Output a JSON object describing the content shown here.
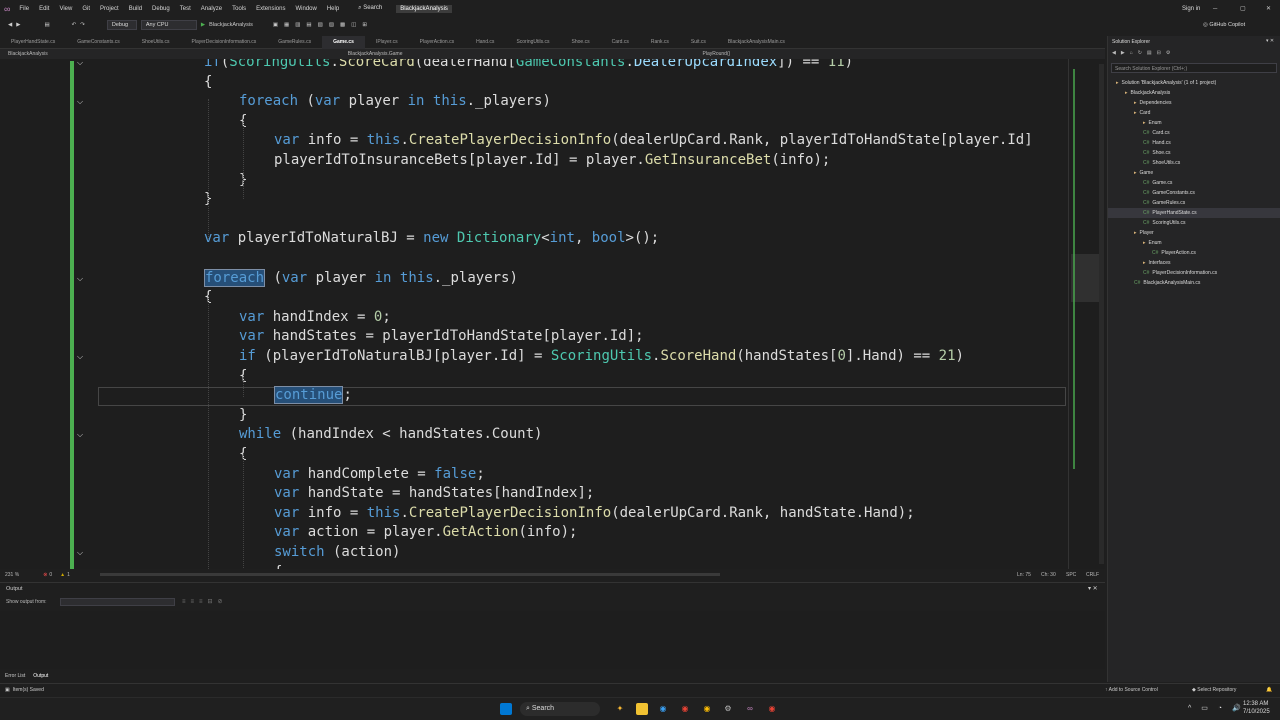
{
  "app": {
    "menu": [
      "File",
      "Edit",
      "View",
      "Git",
      "Project",
      "Build",
      "Debug",
      "Test",
      "Analyze",
      "Tools",
      "Extensions",
      "Window",
      "Help"
    ],
    "search_label": "Search",
    "solution_title": "BlackjackAnalysis",
    "sign_in": "Sign in",
    "copilot": "GitHub Copilot"
  },
  "toolbar": {
    "config": "Debug",
    "platform": "Any CPU",
    "run_target": "BlackjackAnalysis"
  },
  "tabs": [
    {
      "label": "PlayerHandState.cs",
      "active": false
    },
    {
      "label": "GameConstants.cs",
      "active": false
    },
    {
      "label": "ShoeUtils.cs",
      "active": false
    },
    {
      "label": "PlayerDecisionInformation.cs",
      "active": false
    },
    {
      "label": "GameRules.cs",
      "active": false
    },
    {
      "label": "Game.cs",
      "active": true
    },
    {
      "label": "IPlayer.cs",
      "active": false
    },
    {
      "label": "PlayerAction.cs",
      "active": false
    },
    {
      "label": "Hand.cs",
      "active": false
    },
    {
      "label": "ScoringUtils.cs",
      "active": false
    },
    {
      "label": "Shoe.cs",
      "active": false
    },
    {
      "label": "Card.cs",
      "active": false
    },
    {
      "label": "Rank.cs",
      "active": false
    },
    {
      "label": "Suit.cs",
      "active": false
    },
    {
      "label": "BlackjackAnalysisMain.cs",
      "active": false
    }
  ],
  "navbar": {
    "project": "BlackjackAnalysis",
    "scope": "BlackjackAnalysis.Game",
    "member": "PlayRound()"
  },
  "status_line": {
    "zoom": "231 %",
    "errors": "0",
    "warnings": "1",
    "position": "Ln: 75",
    "column": "Ch: 30",
    "whitespace": "SPC",
    "line_ending": "CRLF"
  },
  "output": {
    "title": "Output",
    "show_from_label": "Show output from:"
  },
  "bottom_tabs": [
    "Error List",
    "Output"
  ],
  "solution_explorer": {
    "title": "Solution Explorer",
    "search_placeholder": "Search Solution Explorer (Ctrl+;)",
    "items": [
      {
        "label": "Solution 'BlackjackAnalysis' (1 of 1 project)",
        "indent": 0,
        "selected": false
      },
      {
        "label": "BlackjackAnalysis",
        "indent": 1,
        "selected": false
      },
      {
        "label": "Dependencies",
        "indent": 2,
        "selected": false
      },
      {
        "label": "Card",
        "indent": 2,
        "selected": false
      },
      {
        "label": "Enum",
        "indent": 3,
        "selected": false
      },
      {
        "label": "Card.cs",
        "indent": 3,
        "selected": false
      },
      {
        "label": "Hand.cs",
        "indent": 3,
        "selected": false
      },
      {
        "label": "Shoe.cs",
        "indent": 3,
        "selected": false
      },
      {
        "label": "ShoeUtils.cs",
        "indent": 3,
        "selected": false
      },
      {
        "label": "Game",
        "indent": 2,
        "selected": false
      },
      {
        "label": "Game.cs",
        "indent": 3,
        "selected": false
      },
      {
        "label": "GameConstants.cs",
        "indent": 3,
        "selected": false
      },
      {
        "label": "GameRules.cs",
        "indent": 3,
        "selected": false
      },
      {
        "label": "PlayerHandState.cs",
        "indent": 3,
        "selected": true
      },
      {
        "label": "ScoringUtils.cs",
        "indent": 3,
        "selected": false
      },
      {
        "label": "Player",
        "indent": 2,
        "selected": false
      },
      {
        "label": "Enum",
        "indent": 3,
        "selected": false
      },
      {
        "label": "PlayerAction.cs",
        "indent": 4,
        "selected": false
      },
      {
        "label": "Interfaces",
        "indent": 3,
        "selected": false
      },
      {
        "label": "PlayerDecisionInformation.cs",
        "indent": 3,
        "selected": false
      },
      {
        "label": "BlackjackAnalysisMain.cs",
        "indent": 2,
        "selected": false
      }
    ]
  },
  "vs_status": {
    "message": "Item(s) Saved",
    "source_control": "Add to Source Control",
    "repository": "Select Repository"
  },
  "taskbar": {
    "search_label": "Search",
    "time": "12:38 AM",
    "date": "7/10/2025"
  },
  "code": [
    {
      "indent": 0,
      "tokens": [
        [
          "kw",
          "if"
        ],
        [
          "",
          "("
        ],
        [
          "ty",
          "ScoringUtils"
        ],
        [
          "",
          "."
        ],
        [
          "fn",
          "ScoreCard"
        ],
        [
          "",
          "(dealerHand["
        ],
        [
          "ty",
          "GameConstants"
        ],
        [
          "",
          "."
        ],
        [
          "id",
          "DealerUpcardIndex"
        ],
        [
          "",
          "]) == "
        ],
        [
          "nm",
          "11"
        ],
        [
          "",
          ")"
        ]
      ]
    },
    {
      "indent": 0,
      "tokens": [
        [
          "",
          "{"
        ]
      ]
    },
    {
      "indent": 1,
      "tokens": [
        [
          "kw",
          "foreach"
        ],
        [
          "",
          " ("
        ],
        [
          "kw",
          "var"
        ],
        [
          "",
          " player "
        ],
        [
          "kw",
          "in"
        ],
        [
          "",
          " "
        ],
        [
          "kw",
          "this"
        ],
        [
          "",
          "._players)"
        ]
      ]
    },
    {
      "indent": 1,
      "tokens": [
        [
          "",
          "{"
        ]
      ]
    },
    {
      "indent": 2,
      "tokens": [
        [
          "kw",
          "var"
        ],
        [
          "",
          " info = "
        ],
        [
          "kw",
          "this"
        ],
        [
          "",
          "."
        ],
        [
          "fn",
          "CreatePlayerDecisionInfo"
        ],
        [
          "",
          "(dealerUpCard.Rank, playerIdToHandState[player.Id]"
        ]
      ]
    },
    {
      "indent": 2,
      "tokens": [
        [
          "",
          "playerIdToInsuranceBets[player.Id] = player."
        ],
        [
          "fn",
          "GetInsuranceBet"
        ],
        [
          "",
          "(info);"
        ]
      ]
    },
    {
      "indent": 1,
      "tokens": [
        [
          "",
          "}"
        ]
      ]
    },
    {
      "indent": 0,
      "tokens": [
        [
          "",
          "}"
        ]
      ]
    },
    {
      "indent": 0,
      "tokens": []
    },
    {
      "indent": 0,
      "tokens": [
        [
          "kw",
          "var"
        ],
        [
          "",
          " playerIdToNaturalBJ = "
        ],
        [
          "kw",
          "new"
        ],
        [
          "",
          " "
        ],
        [
          "ty",
          "Dictionary"
        ],
        [
          "",
          "<"
        ],
        [
          "kw",
          "int"
        ],
        [
          "",
          ", "
        ],
        [
          "kw",
          "bool"
        ],
        [
          "",
          ">();"
        ]
      ]
    },
    {
      "indent": 0,
      "tokens": []
    },
    {
      "indent": 0,
      "tokens": [
        [
          "kw hl",
          "foreach"
        ],
        [
          "",
          " ("
        ],
        [
          "kw",
          "var"
        ],
        [
          "",
          " player "
        ],
        [
          "kw",
          "in"
        ],
        [
          "",
          " "
        ],
        [
          "kw",
          "this"
        ],
        [
          "",
          "._players)"
        ]
      ]
    },
    {
      "indent": 0,
      "tokens": [
        [
          "",
          "{"
        ]
      ]
    },
    {
      "indent": 1,
      "tokens": [
        [
          "kw",
          "var"
        ],
        [
          "",
          " handIndex = "
        ],
        [
          "nm",
          "0"
        ],
        [
          "",
          ";"
        ]
      ]
    },
    {
      "indent": 1,
      "tokens": [
        [
          "kw",
          "var"
        ],
        [
          "",
          " handStates = playerIdToHandState[player.Id];"
        ]
      ]
    },
    {
      "indent": 1,
      "tokens": [
        [
          "kw",
          "if"
        ],
        [
          "",
          " (playerIdToNaturalBJ[player.Id] = "
        ],
        [
          "ty",
          "ScoringUtils"
        ],
        [
          "",
          "."
        ],
        [
          "fn",
          "ScoreHand"
        ],
        [
          "",
          "(handStates["
        ],
        [
          "nm",
          "0"
        ],
        [
          "",
          "].Hand) == "
        ],
        [
          "nm",
          "21"
        ],
        [
          "",
          ")"
        ]
      ]
    },
    {
      "indent": 1,
      "tokens": [
        [
          "",
          "{"
        ]
      ]
    },
    {
      "indent": 2,
      "tokens": [
        [
          "kw hl",
          "continue"
        ],
        [
          "",
          ";"
        ]
      ]
    },
    {
      "indent": 1,
      "tokens": [
        [
          "",
          "}"
        ]
      ]
    },
    {
      "indent": 1,
      "tokens": [
        [
          "kw",
          "while"
        ],
        [
          "",
          " (handIndex < handStates.Count)"
        ]
      ]
    },
    {
      "indent": 1,
      "tokens": [
        [
          "",
          "{"
        ]
      ]
    },
    {
      "indent": 2,
      "tokens": [
        [
          "kw",
          "var"
        ],
        [
          "",
          " handComplete = "
        ],
        [
          "kw",
          "false"
        ],
        [
          "",
          ";"
        ]
      ]
    },
    {
      "indent": 2,
      "tokens": [
        [
          "kw",
          "var"
        ],
        [
          "",
          " handState = handStates[handIndex];"
        ]
      ]
    },
    {
      "indent": 2,
      "tokens": [
        [
          "kw",
          "var"
        ],
        [
          "",
          " info = "
        ],
        [
          "kw",
          "this"
        ],
        [
          "",
          "."
        ],
        [
          "fn",
          "CreatePlayerDecisionInfo"
        ],
        [
          "",
          "(dealerUpCard.Rank, handState.Hand);"
        ]
      ]
    },
    {
      "indent": 2,
      "tokens": [
        [
          "kw",
          "var"
        ],
        [
          "",
          " action = player."
        ],
        [
          "fn",
          "GetAction"
        ],
        [
          "",
          "(info);"
        ]
      ]
    },
    {
      "indent": 2,
      "tokens": [
        [
          "kw",
          "switch"
        ],
        [
          "",
          " (action)"
        ]
      ]
    },
    {
      "indent": 2,
      "tokens": [
        [
          "",
          "{"
        ]
      ]
    }
  ],
  "colors": {
    "keyword": "#569cd6",
    "type": "#4ec9b0",
    "method": "#dcdcaa",
    "number": "#b5cea8",
    "change_bar": "#4caf50"
  }
}
